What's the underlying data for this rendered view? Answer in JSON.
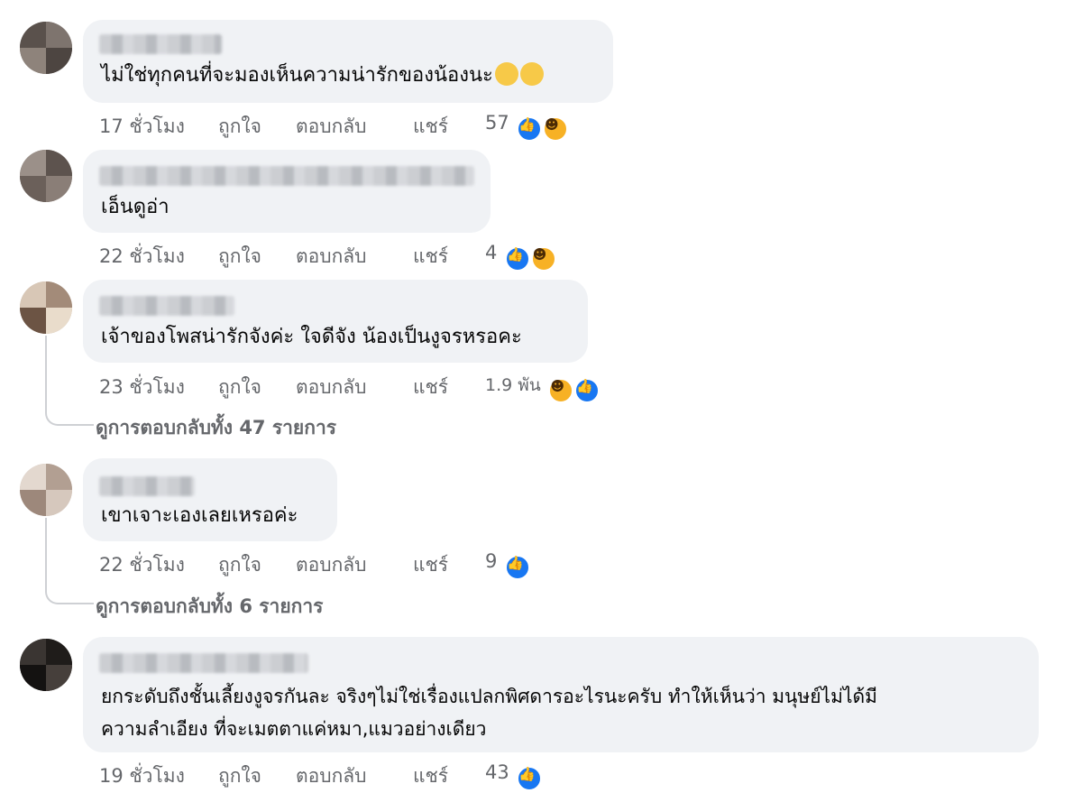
{
  "comments": [
    {
      "text": "ไม่ใช่ทุกคนที่จะมองเห็นความน่ารักของน้องนะ",
      "emoji": [
        "😲",
        "😁"
      ],
      "time": "17 ชั่วโมง",
      "like": "ถูกใจ",
      "reply": "ตอบกลับ",
      "share": "แชร์",
      "reactions_count": "57",
      "reactions": [
        "like-icon",
        "haha-icon"
      ]
    },
    {
      "text": "เอ็นดูอ่า",
      "time": "22 ชั่วโมง",
      "like": "ถูกใจ",
      "reply": "ตอบกลับ",
      "share": "แชร์",
      "reactions_count": "4",
      "reactions": [
        "like-icon",
        "haha-icon"
      ]
    },
    {
      "text": "เจ้าของโพสน่ารักจังค่ะ ใจดีจัง น้องเป็นงูจรหรอคะ",
      "time": "23 ชั่วโมง",
      "like": "ถูกใจ",
      "reply": "ตอบกลับ",
      "share": "แชร์",
      "reactions_count": "1.9 พัน",
      "reactions": [
        "haha-icon",
        "like-icon"
      ],
      "view_replies": "ดูการตอบกลับทั้ง 47 รายการ"
    },
    {
      "text": "เขาเจาะเองเลยเหรอค่ะ",
      "time": "22 ชั่วโมง",
      "like": "ถูกใจ",
      "reply": "ตอบกลับ",
      "share": "แชร์",
      "reactions_count": "9",
      "reactions": [
        "like-icon"
      ],
      "view_replies": "ดูการตอบกลับทั้ง 6 รายการ"
    },
    {
      "text_line1": "ยกระดับถึงชั้นเลี้ยงงูจรกันละ จริงๆไม่ใช่เรื่องแปลกพิศดารอะไรนะครับ ทำให้เห็นว่า มนุษย์ไม่ได้มี",
      "text_line2": "ความลำเอียง ที่จะเมตตาแค่หมา,แมวอย่างเดียว",
      "time": "19 ชั่วโมง",
      "like": "ถูกใจ",
      "reply": "ตอบกลับ",
      "share": "แชร์",
      "reactions_count": "43",
      "reactions": [
        "like-icon"
      ]
    }
  ],
  "colors": {
    "bubble": "#f0f2f5",
    "meta": "#65676b",
    "like_blue": "#1877f2",
    "haha_yellow": "#f7b125"
  }
}
